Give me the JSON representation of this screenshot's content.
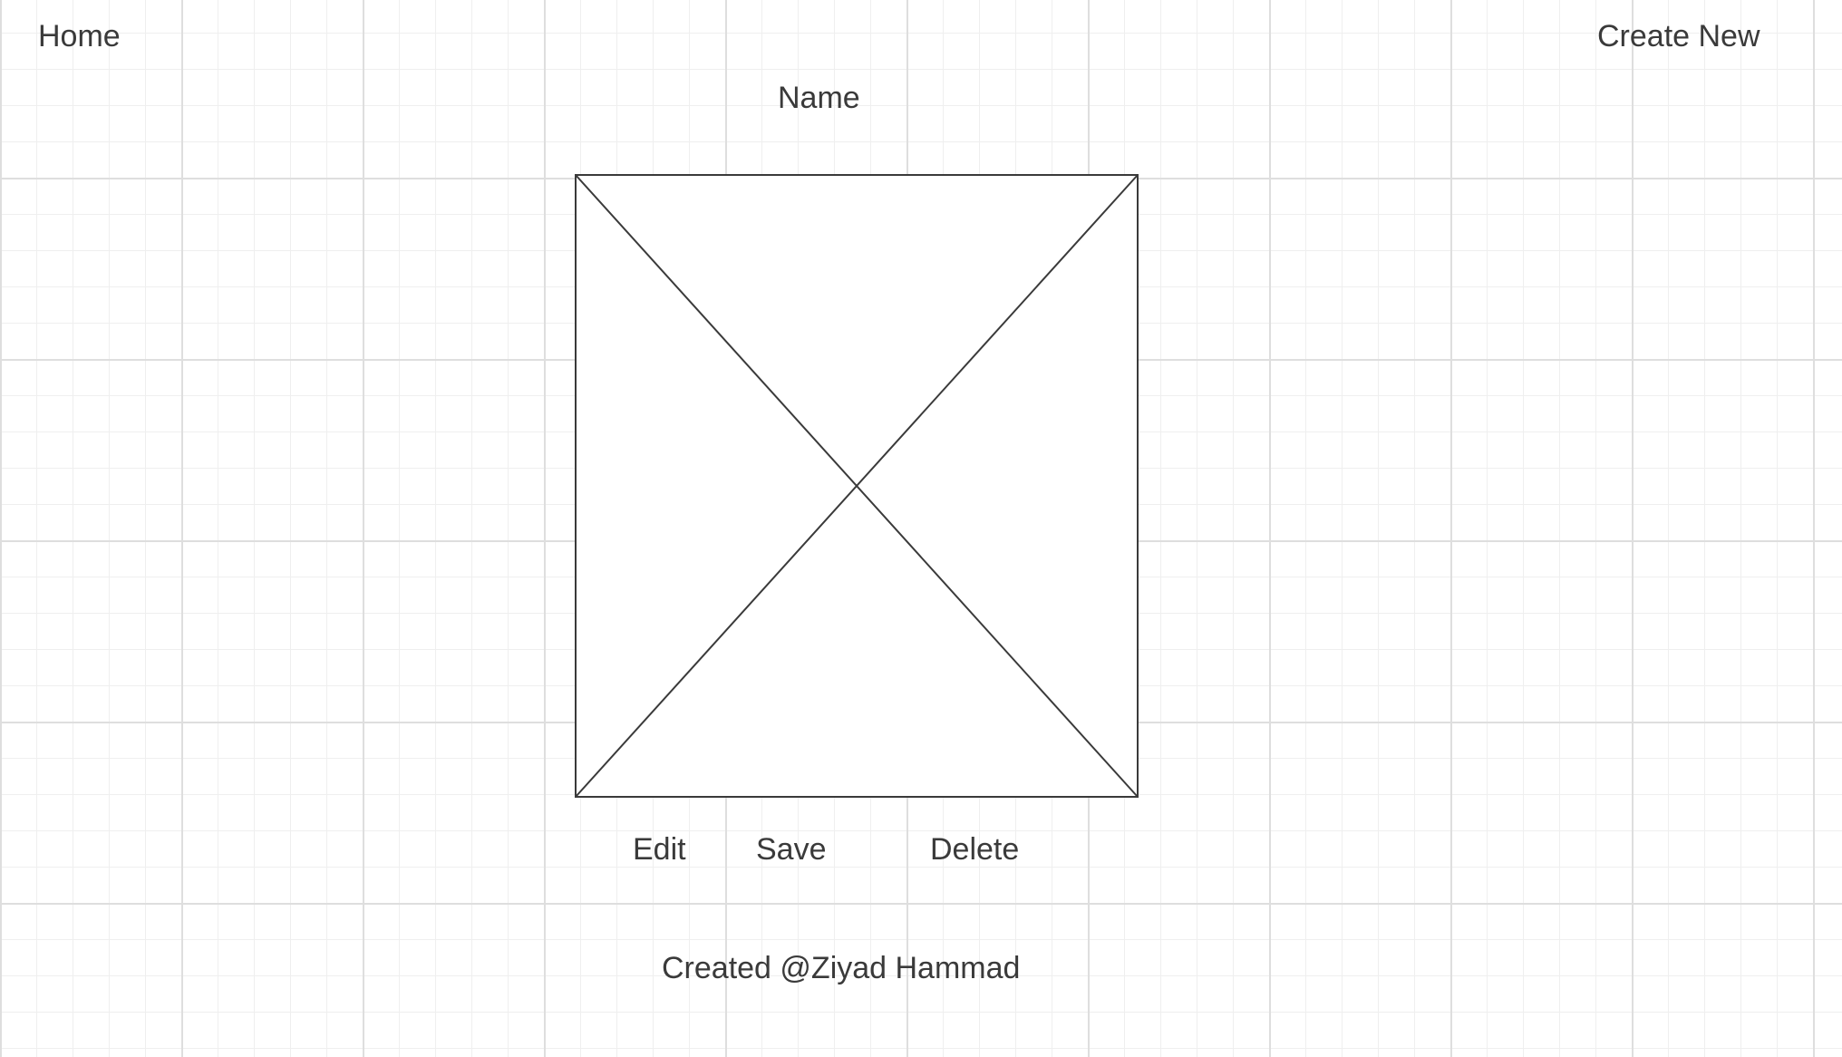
{
  "nav": {
    "home_label": "Home",
    "create_new_label": "Create New"
  },
  "item": {
    "name": "Name",
    "image_icon": "image-placeholder-icon"
  },
  "actions": {
    "edit_label": "Edit",
    "save_label": "Save",
    "delete_label": "Delete"
  },
  "footer": {
    "credit": "Created @Ziyad Hammad"
  },
  "colors": {
    "text": "#3a3a3a",
    "grid_major": "#dedede",
    "grid_minor": "#efefef",
    "outline": "#3a3a3a",
    "background": "#ffffff"
  }
}
